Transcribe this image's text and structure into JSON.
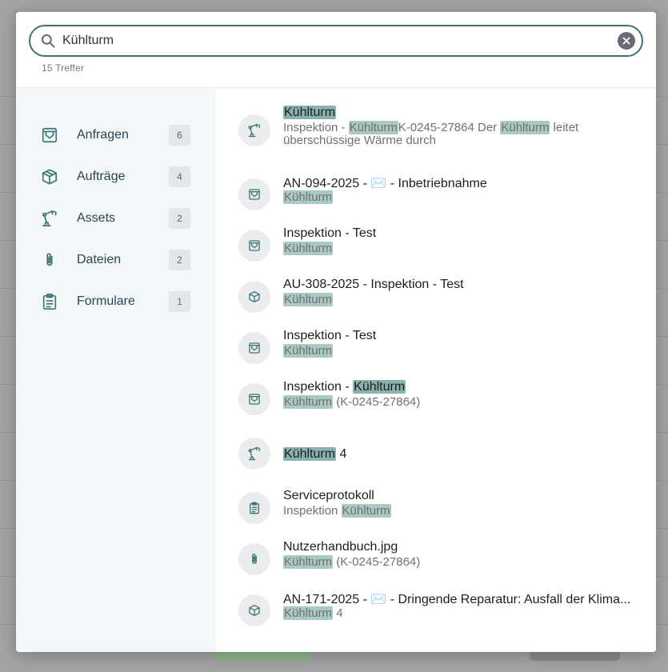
{
  "search": {
    "value": "Kühlturm",
    "result_count": "15 Treffer"
  },
  "categories": [
    {
      "label": "Anfragen",
      "count": "6",
      "icon": "inbox-icon"
    },
    {
      "label": "Aufträge",
      "count": "4",
      "icon": "package-icon"
    },
    {
      "label": "Assets",
      "count": "2",
      "icon": "robot-arm-icon"
    },
    {
      "label": "Dateien",
      "count": "2",
      "icon": "paperclip-icon"
    },
    {
      "label": "Formulare",
      "count": "1",
      "icon": "clipboard-icon"
    }
  ],
  "results": [
    {
      "icon": "robot-arm-icon",
      "title": "Kühlturm",
      "subtitle": {
        "p1": "Inspektion - ",
        "h1": "Kühlturm",
        "p2": "K-0245-27864 Der ",
        "h2": "Kühlturm",
        "p3": " leitet überschüssige Wärme durch"
      }
    },
    {
      "icon": "inbox-icon",
      "title": "AN-094-2025 - ✉️ - Inbetriebnahme",
      "sub_hl": "Kühlturm",
      "sub_rest": ""
    },
    {
      "icon": "inbox-icon",
      "title": "Inspektion - Test",
      "sub_hl": "Kühlturm",
      "sub_rest": ""
    },
    {
      "icon": "package-icon",
      "title": "AU-308-2025 - Inspektion - Test",
      "sub_hl": "Kühlturm",
      "sub_rest": ""
    },
    {
      "icon": "inbox-icon",
      "title": "Inspektion - Test",
      "sub_hl": "Kühlturm",
      "sub_rest": ""
    },
    {
      "icon": "inbox-icon",
      "title_pre": "Inspektion - ",
      "title_hl": "Kühlturm",
      "sub_hl": "Kühlturm",
      "sub_rest": " (K-0245-27864)"
    },
    {
      "icon": "robot-arm-icon",
      "title_hl": "Kühlturm",
      "title_post": " 4"
    },
    {
      "icon": "clipboard-icon",
      "title": "Serviceprotokoll",
      "sub_pre": "Inspektion ",
      "sub_hl": "Kühlturm"
    },
    {
      "icon": "paperclip-icon",
      "title": "Nutzerhandbuch.jpg",
      "sub_hl": "Kühlturm",
      "sub_rest": " (K-0245-27864)"
    },
    {
      "icon": "package-icon",
      "title": "AN-171-2025 - ✉️ - Dringende Reparatur: Ausfall der Klima...",
      "sub_hl": "Kühlturm",
      "sub_rest": " 4"
    }
  ],
  "colors": {
    "accent": "#3d7373",
    "highlight": "#a9c9c6",
    "sidebar_bg": "#f2f7f9"
  }
}
